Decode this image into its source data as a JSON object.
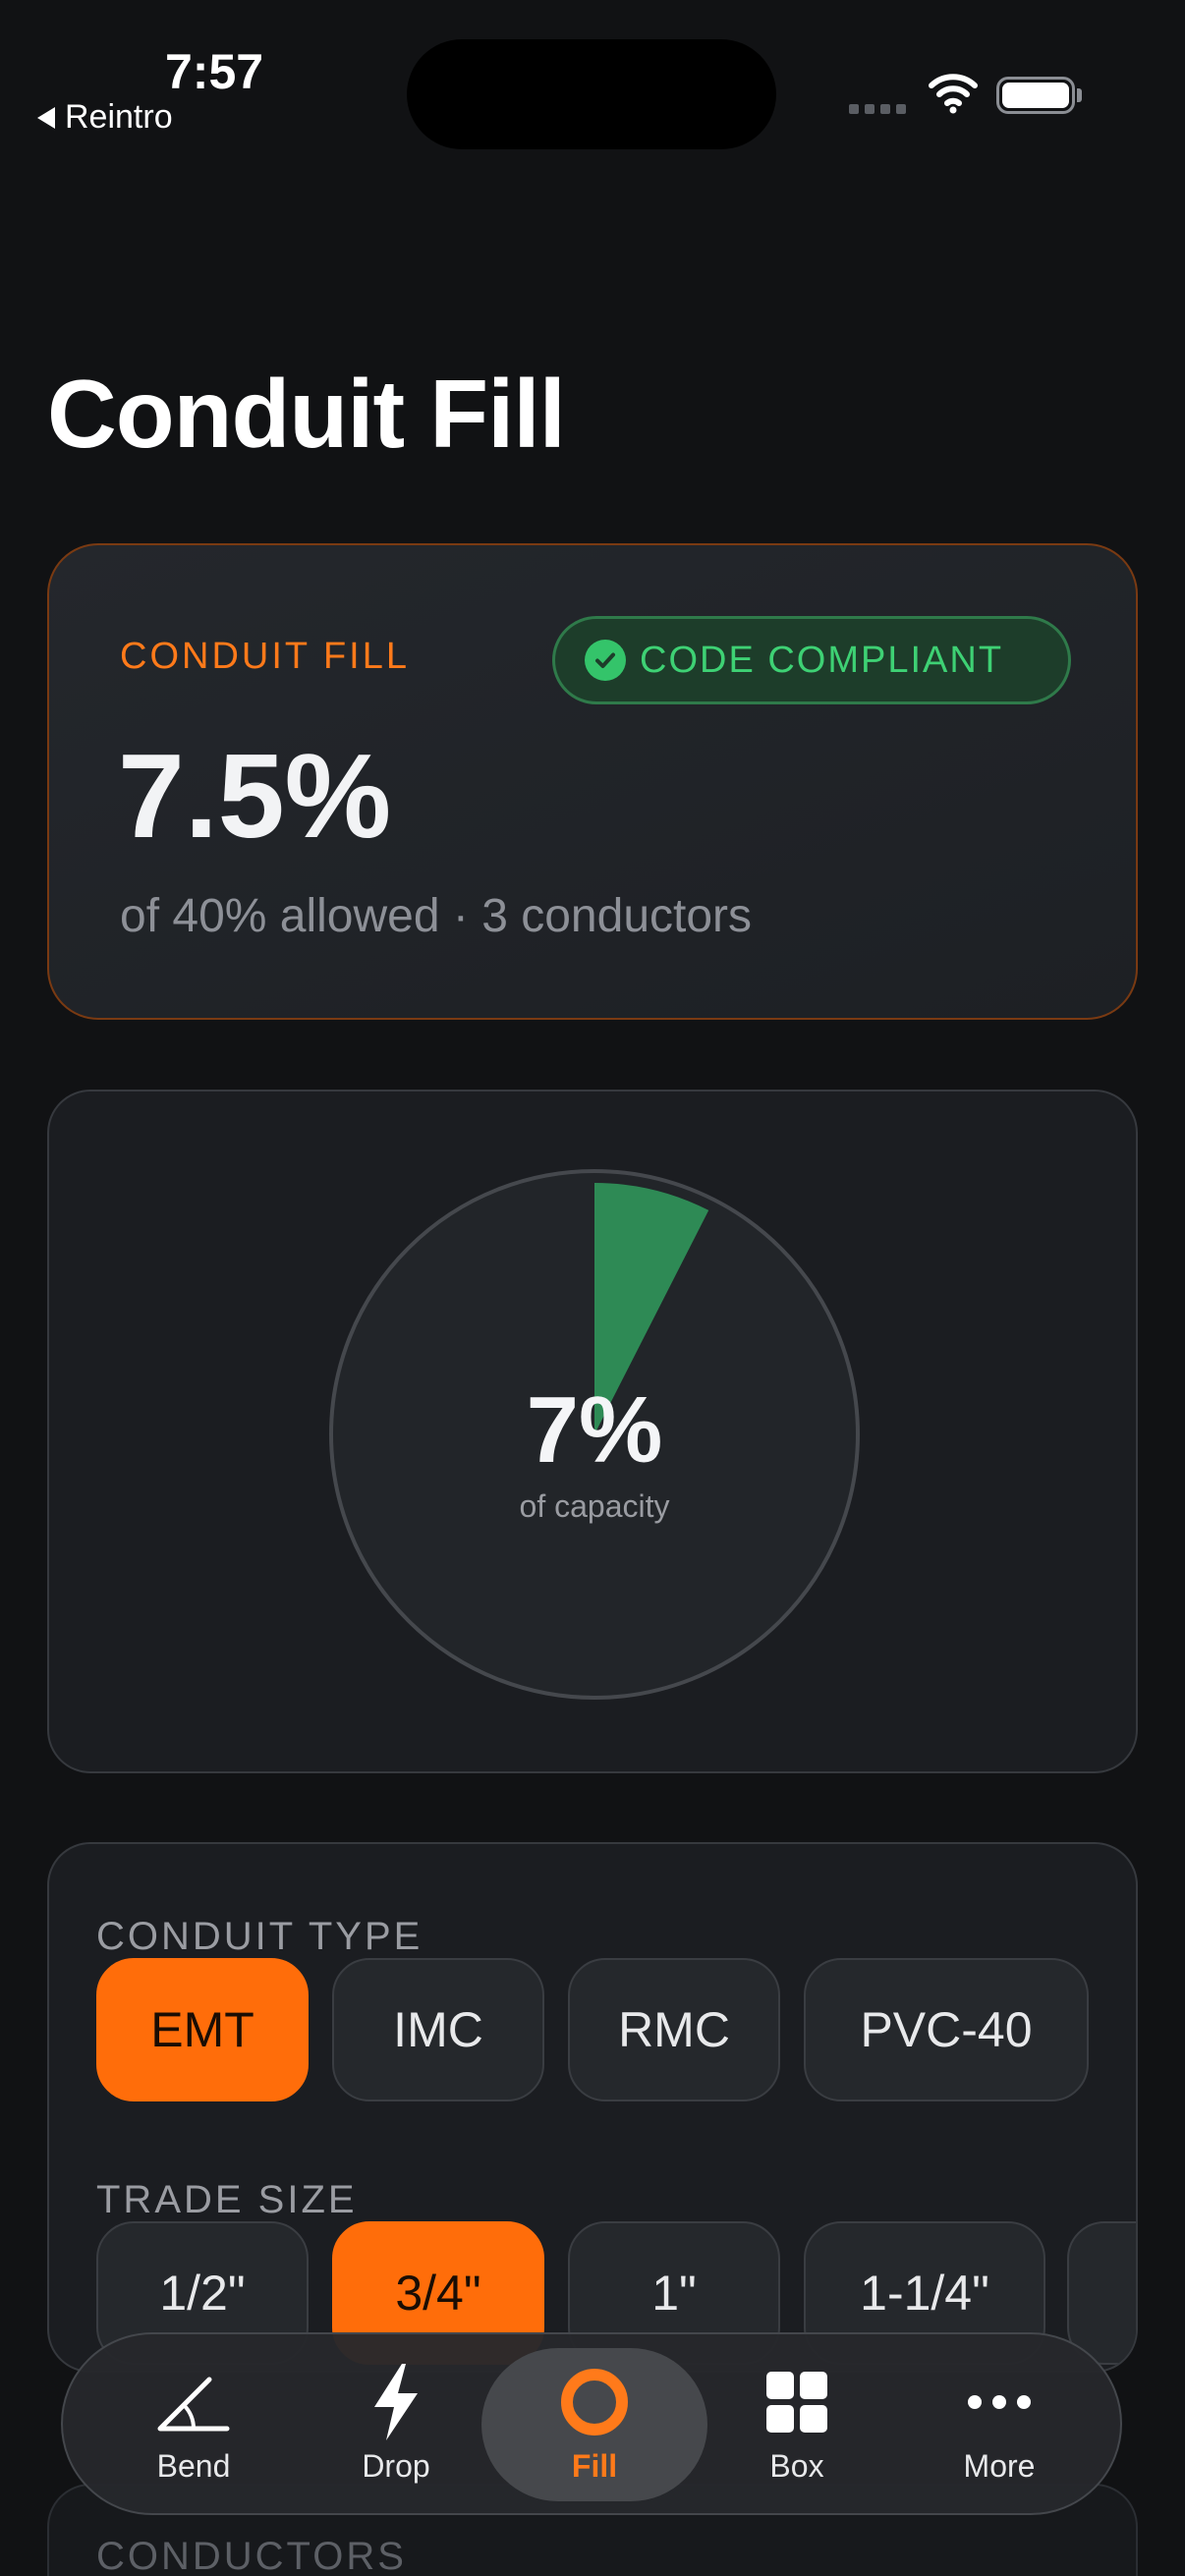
{
  "status_bar": {
    "time": "7:57",
    "back_label": "Reintro"
  },
  "page": {
    "title": "Conduit Fill"
  },
  "summary": {
    "label": "CONDUIT FILL",
    "badge": "CODE COMPLIANT",
    "value": "7.5%",
    "subtitle": "of 40% allowed · 3 conductors",
    "accent_color": "#ff7a1a",
    "badge_color": "#3ed174"
  },
  "chart_data": {
    "type": "pie",
    "values": [
      7.5,
      92.5
    ],
    "center_value": "7%",
    "center_label": "of capacity",
    "colors": [
      "#2e8a55",
      "#222529"
    ]
  },
  "conduit_type": {
    "label": "CONDUIT TYPE",
    "options": [
      "EMT",
      "IMC",
      "RMC",
      "PVC-40"
    ],
    "selected": "EMT"
  },
  "trade_size": {
    "label": "TRADE SIZE",
    "options": [
      "1/2\"",
      "3/4\"",
      "1\"",
      "1-1/4\""
    ],
    "selected": "3/4\""
  },
  "conductors": {
    "label": "CONDUCTORS"
  },
  "tabbar": {
    "items": [
      {
        "label": "Bend",
        "icon": "angle-icon"
      },
      {
        "label": "Drop",
        "icon": "bolt-icon"
      },
      {
        "label": "Fill",
        "icon": "ring-icon"
      },
      {
        "label": "Box",
        "icon": "grid-icon"
      },
      {
        "label": "More",
        "icon": "ellipsis-icon"
      }
    ],
    "active": "Fill"
  }
}
